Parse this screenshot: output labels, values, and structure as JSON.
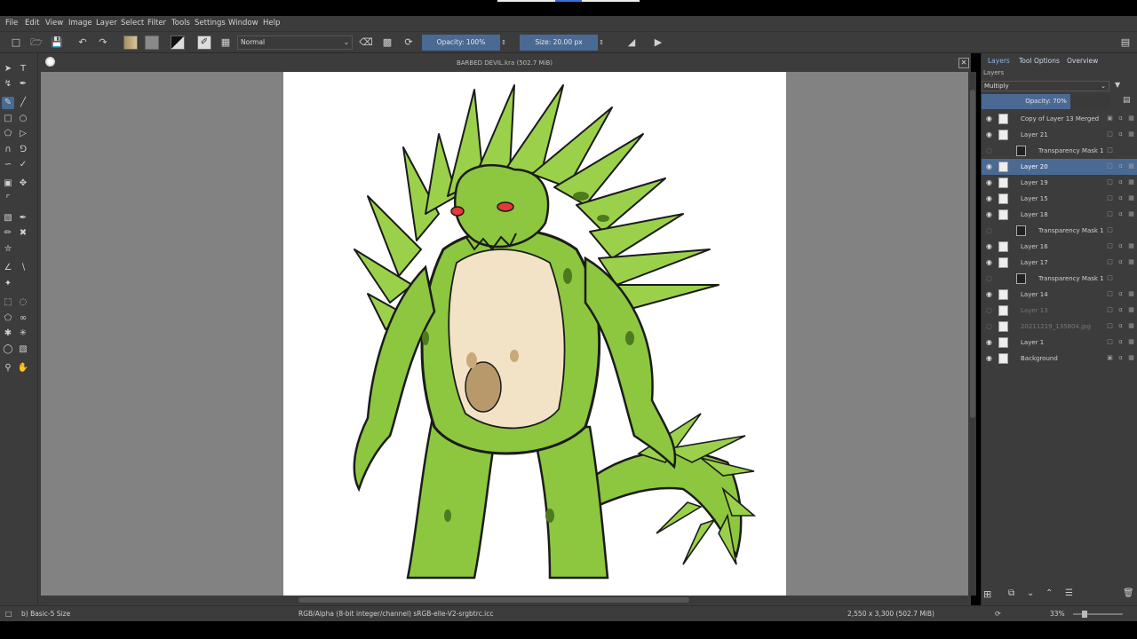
{
  "menu": [
    "File",
    "Edit",
    "View",
    "Image",
    "Layer",
    "Select",
    "Filter",
    "Tools",
    "Settings",
    "Window",
    "Help"
  ],
  "toolbar": {
    "blend_mode": "Normal",
    "opacity_label": "Opacity: 100%",
    "size_label": "Size: 20.00 px"
  },
  "canvas": {
    "document_title": "BARBED DEVIL.kra (502.7 MiB)"
  },
  "docker": {
    "tabs": [
      "Layers",
      "Tool Options",
      "Overview"
    ],
    "panel_title": "Layers",
    "blend_mode": "Multiply",
    "opacity_label": "Opacity:  70%",
    "layers": [
      {
        "name": "Copy of Layer 13 Merged",
        "visible": true,
        "indent": 0,
        "locked": true
      },
      {
        "name": "Layer 21",
        "visible": true,
        "indent": 0,
        "locked": false
      },
      {
        "name": "Transparency Mask 1",
        "visible": false,
        "indent": 1,
        "locked": false
      },
      {
        "name": "Layer 20",
        "visible": true,
        "indent": 0,
        "locked": false,
        "selected": true
      },
      {
        "name": "Layer 19",
        "visible": true,
        "indent": 0,
        "locked": false
      },
      {
        "name": "Layer 15",
        "visible": true,
        "indent": 0,
        "locked": false
      },
      {
        "name": "Layer 18",
        "visible": true,
        "indent": 0,
        "locked": false
      },
      {
        "name": "Transparency Mask 1",
        "visible": false,
        "indent": 1,
        "locked": false
      },
      {
        "name": "Layer 16",
        "visible": true,
        "indent": 0,
        "locked": false
      },
      {
        "name": "Layer 17",
        "visible": true,
        "indent": 0,
        "locked": false
      },
      {
        "name": "Transparency Mask 1",
        "visible": false,
        "indent": 1,
        "locked": false
      },
      {
        "name": "Layer 14",
        "visible": true,
        "indent": 0,
        "locked": false
      },
      {
        "name": "Layer 13",
        "visible": false,
        "indent": 0,
        "locked": false,
        "dim": true
      },
      {
        "name": "20211219_135804.jpg",
        "visible": false,
        "indent": 0,
        "locked": false,
        "dim": true
      },
      {
        "name": "Layer 1",
        "visible": true,
        "indent": 0,
        "locked": false
      },
      {
        "name": "Background",
        "visible": true,
        "indent": 0,
        "locked": true
      }
    ]
  },
  "status": {
    "brush": "b) Basic-5 Size",
    "color_space": "RGB/Alpha (8-bit integer/channel)  sRGB-elle-V2-srgbtrc.icc",
    "dimensions": "2,550 x 3,300 (502.7 MiB)",
    "zoom": "33%"
  },
  "colors": {
    "accent": "#4a6a94",
    "panel": "#3c3c3c",
    "canvas_bg": "#828282",
    "creature_green": "#8dc63f",
    "belly": "#f3e3c6"
  }
}
